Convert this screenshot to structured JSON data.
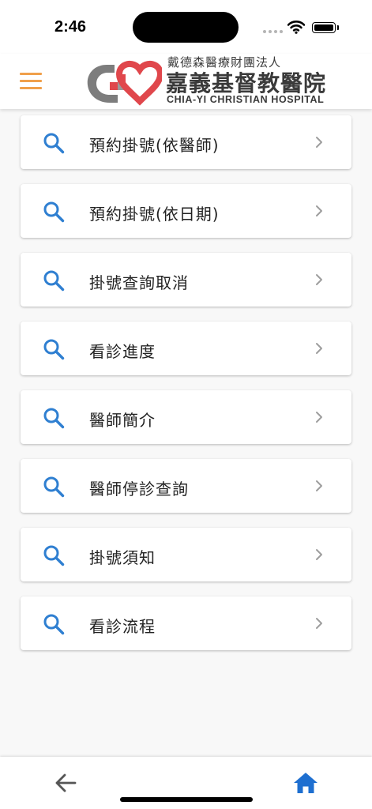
{
  "status_bar": {
    "time": "2:46"
  },
  "header": {
    "logo": {
      "foundation": "戴德森醫療財團法人",
      "name": "嘉義基督教醫院",
      "english_name": "CHIA-YI CHRISTIAN HOSPITAL"
    }
  },
  "menu": {
    "items": [
      {
        "label": "預約掛號(依醫師)",
        "icon": "search-icon"
      },
      {
        "label": "預約掛號(依日期)",
        "icon": "search-icon"
      },
      {
        "label": "掛號查詢取消",
        "icon": "search-icon"
      },
      {
        "label": "看診進度",
        "icon": "search-icon"
      },
      {
        "label": "醫師簡介",
        "icon": "search-icon"
      },
      {
        "label": "醫師停診查詢",
        "icon": "search-icon"
      },
      {
        "label": "掛號須知",
        "icon": "search-icon"
      },
      {
        "label": "看診流程",
        "icon": "search-icon"
      }
    ]
  },
  "colors": {
    "accent_orange": "#f0a04b",
    "icon_blue": "#2f7fd1",
    "home_blue": "#1e6fd0",
    "logo_red": "#e0474c",
    "logo_gray": "#7d7d7d"
  }
}
